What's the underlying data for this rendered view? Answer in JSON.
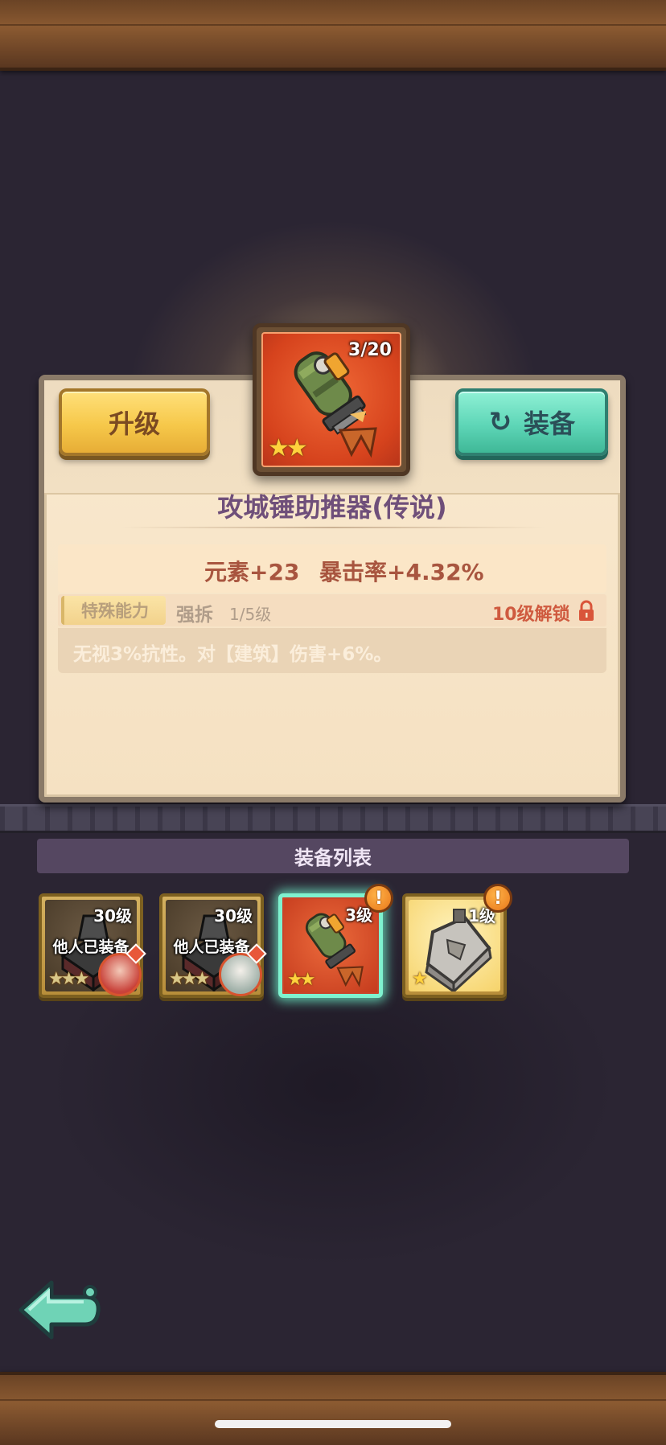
{
  "item": {
    "count": "3/20",
    "stars": 2,
    "name": "攻城锤助推器(传说)",
    "icon": "rocket-booster-icon"
  },
  "actions": {
    "upgrade_label": "升级",
    "equip_label": "装备"
  },
  "stats": {
    "element_label": "元素",
    "element_value": "+23",
    "crit_label": "暴击率",
    "crit_value": "+4.32%"
  },
  "ability": {
    "tag": "特殊能力",
    "name": "强拆",
    "level": "1/5级",
    "unlock": "10级解锁",
    "description": "无视3%抗性。对【建筑】伤害+6%。"
  },
  "equipment_list": {
    "title": "装备列表",
    "items": [
      {
        "level": "30级",
        "status": "他人已装备",
        "stars": 3,
        "icon": "stone-armor-icon"
      },
      {
        "level": "30级",
        "status": "他人已装备",
        "stars": 3,
        "icon": "stone-armor-icon"
      },
      {
        "level": "3级",
        "status": "",
        "stars": 2,
        "icon": "rocket-booster-icon",
        "selected": true,
        "alert": "!"
      },
      {
        "level": "1级",
        "status": "",
        "stars": 1,
        "icon": "metal-plate-icon",
        "alert": "!"
      }
    ]
  },
  "colors": {
    "upgrade": "#f6c84a",
    "equip": "#5ed6b7",
    "selected_glow": "#7ff2cf",
    "accent_text": "#a8553f"
  }
}
